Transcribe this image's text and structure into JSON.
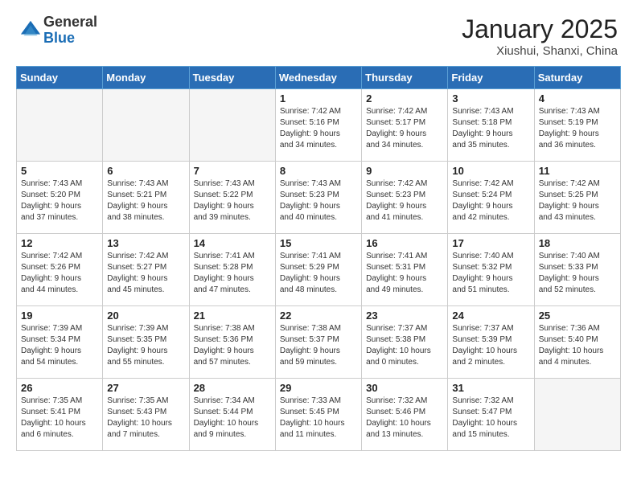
{
  "logo": {
    "general": "General",
    "blue": "Blue"
  },
  "title": "January 2025",
  "location": "Xiushui, Shanxi, China",
  "weekdays": [
    "Sunday",
    "Monday",
    "Tuesday",
    "Wednesday",
    "Thursday",
    "Friday",
    "Saturday"
  ],
  "weeks": [
    [
      {
        "num": "",
        "info": ""
      },
      {
        "num": "",
        "info": ""
      },
      {
        "num": "",
        "info": ""
      },
      {
        "num": "1",
        "info": "Sunrise: 7:42 AM\nSunset: 5:16 PM\nDaylight: 9 hours\nand 34 minutes."
      },
      {
        "num": "2",
        "info": "Sunrise: 7:42 AM\nSunset: 5:17 PM\nDaylight: 9 hours\nand 34 minutes."
      },
      {
        "num": "3",
        "info": "Sunrise: 7:43 AM\nSunset: 5:18 PM\nDaylight: 9 hours\nand 35 minutes."
      },
      {
        "num": "4",
        "info": "Sunrise: 7:43 AM\nSunset: 5:19 PM\nDaylight: 9 hours\nand 36 minutes."
      }
    ],
    [
      {
        "num": "5",
        "info": "Sunrise: 7:43 AM\nSunset: 5:20 PM\nDaylight: 9 hours\nand 37 minutes."
      },
      {
        "num": "6",
        "info": "Sunrise: 7:43 AM\nSunset: 5:21 PM\nDaylight: 9 hours\nand 38 minutes."
      },
      {
        "num": "7",
        "info": "Sunrise: 7:43 AM\nSunset: 5:22 PM\nDaylight: 9 hours\nand 39 minutes."
      },
      {
        "num": "8",
        "info": "Sunrise: 7:43 AM\nSunset: 5:23 PM\nDaylight: 9 hours\nand 40 minutes."
      },
      {
        "num": "9",
        "info": "Sunrise: 7:42 AM\nSunset: 5:23 PM\nDaylight: 9 hours\nand 41 minutes."
      },
      {
        "num": "10",
        "info": "Sunrise: 7:42 AM\nSunset: 5:24 PM\nDaylight: 9 hours\nand 42 minutes."
      },
      {
        "num": "11",
        "info": "Sunrise: 7:42 AM\nSunset: 5:25 PM\nDaylight: 9 hours\nand 43 minutes."
      }
    ],
    [
      {
        "num": "12",
        "info": "Sunrise: 7:42 AM\nSunset: 5:26 PM\nDaylight: 9 hours\nand 44 minutes."
      },
      {
        "num": "13",
        "info": "Sunrise: 7:42 AM\nSunset: 5:27 PM\nDaylight: 9 hours\nand 45 minutes."
      },
      {
        "num": "14",
        "info": "Sunrise: 7:41 AM\nSunset: 5:28 PM\nDaylight: 9 hours\nand 47 minutes."
      },
      {
        "num": "15",
        "info": "Sunrise: 7:41 AM\nSunset: 5:29 PM\nDaylight: 9 hours\nand 48 minutes."
      },
      {
        "num": "16",
        "info": "Sunrise: 7:41 AM\nSunset: 5:31 PM\nDaylight: 9 hours\nand 49 minutes."
      },
      {
        "num": "17",
        "info": "Sunrise: 7:40 AM\nSunset: 5:32 PM\nDaylight: 9 hours\nand 51 minutes."
      },
      {
        "num": "18",
        "info": "Sunrise: 7:40 AM\nSunset: 5:33 PM\nDaylight: 9 hours\nand 52 minutes."
      }
    ],
    [
      {
        "num": "19",
        "info": "Sunrise: 7:39 AM\nSunset: 5:34 PM\nDaylight: 9 hours\nand 54 minutes."
      },
      {
        "num": "20",
        "info": "Sunrise: 7:39 AM\nSunset: 5:35 PM\nDaylight: 9 hours\nand 55 minutes."
      },
      {
        "num": "21",
        "info": "Sunrise: 7:38 AM\nSunset: 5:36 PM\nDaylight: 9 hours\nand 57 minutes."
      },
      {
        "num": "22",
        "info": "Sunrise: 7:38 AM\nSunset: 5:37 PM\nDaylight: 9 hours\nand 59 minutes."
      },
      {
        "num": "23",
        "info": "Sunrise: 7:37 AM\nSunset: 5:38 PM\nDaylight: 10 hours\nand 0 minutes."
      },
      {
        "num": "24",
        "info": "Sunrise: 7:37 AM\nSunset: 5:39 PM\nDaylight: 10 hours\nand 2 minutes."
      },
      {
        "num": "25",
        "info": "Sunrise: 7:36 AM\nSunset: 5:40 PM\nDaylight: 10 hours\nand 4 minutes."
      }
    ],
    [
      {
        "num": "26",
        "info": "Sunrise: 7:35 AM\nSunset: 5:41 PM\nDaylight: 10 hours\nand 6 minutes."
      },
      {
        "num": "27",
        "info": "Sunrise: 7:35 AM\nSunset: 5:43 PM\nDaylight: 10 hours\nand 7 minutes."
      },
      {
        "num": "28",
        "info": "Sunrise: 7:34 AM\nSunset: 5:44 PM\nDaylight: 10 hours\nand 9 minutes."
      },
      {
        "num": "29",
        "info": "Sunrise: 7:33 AM\nSunset: 5:45 PM\nDaylight: 10 hours\nand 11 minutes."
      },
      {
        "num": "30",
        "info": "Sunrise: 7:32 AM\nSunset: 5:46 PM\nDaylight: 10 hours\nand 13 minutes."
      },
      {
        "num": "31",
        "info": "Sunrise: 7:32 AM\nSunset: 5:47 PM\nDaylight: 10 hours\nand 15 minutes."
      },
      {
        "num": "",
        "info": ""
      }
    ]
  ]
}
